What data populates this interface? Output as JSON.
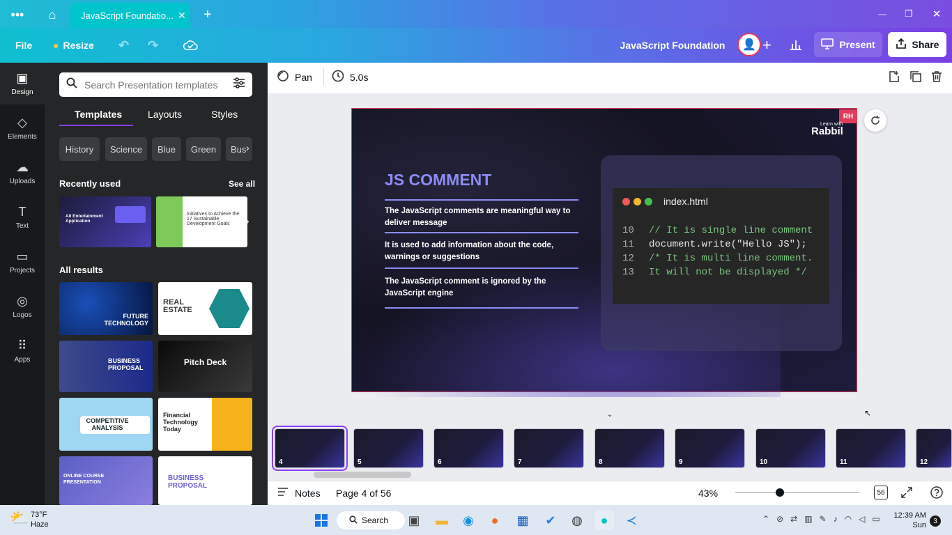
{
  "browser": {
    "tab_title": "JavaScript Foundatio...",
    "tab_close": "✕",
    "new_tab": "+",
    "window_controls": [
      "—",
      "❐",
      "✕"
    ]
  },
  "header": {
    "file": "File",
    "resize": "Resize",
    "doc_title": "JavaScript Foundation",
    "present": "Present",
    "share": "Share"
  },
  "rail": [
    "Design",
    "Elements",
    "Uploads",
    "Text",
    "Projects",
    "Logos",
    "Apps"
  ],
  "panel": {
    "search_placeholder": "Search Presentation templates",
    "tabs": [
      "Templates",
      "Layouts",
      "Styles"
    ],
    "chips": [
      "History",
      "Science",
      "Blue",
      "Green",
      "Bus"
    ],
    "recently_used": "Recently used",
    "see_all": "See all",
    "all_results": "All results",
    "recent": [
      {
        "title": "All Entertainment Application"
      },
      {
        "title": "Initiatives to Achieve the 17 Sustainable Development Goals"
      }
    ],
    "results": [
      {
        "title": "FUTURE TECHNOLOGY"
      },
      {
        "title": "REAL ESTATE"
      },
      {
        "title": "BUSINESS PROPOSAL"
      },
      {
        "title": "Pitch Deck"
      },
      {
        "title": "COMPETITIVE ANALYSIS"
      },
      {
        "title": "Financial Technology Today"
      },
      {
        "title": "ONLINE COURSE PRESENTATION"
      },
      {
        "title": "BUSINESS PROPOSAL"
      }
    ]
  },
  "toolbar": {
    "pan": "Pan",
    "duration": "5.0s"
  },
  "slide": {
    "badge": "RH",
    "logo_small": "Learn with",
    "logo_big": "Rabbil",
    "title": "JS COMMENT",
    "bullets": [
      "The JavaScript comments are meaningful way to deliver message",
      "It is used to add information about the code, warnings or suggestions",
      "The JavaScript comment is ignored by the JavaScript engine"
    ],
    "file_name": "index.html",
    "code": [
      {
        "num": "10",
        "text": "// It is single line comment",
        "color": "#7bc47f"
      },
      {
        "num": "11",
        "text": "document.write(\"Hello JS\");",
        "color": "#e8e8e8"
      },
      {
        "num": "12",
        "text": "/* It is multi line comment.",
        "color": "#7bc47f"
      },
      {
        "num": "13",
        "text": "It will not be displayed */",
        "color": "#7bc47f"
      }
    ]
  },
  "filmstrip": [
    "4",
    "5",
    "6",
    "7",
    "8",
    "9",
    "10",
    "11",
    "12"
  ],
  "status": {
    "notes": "Notes",
    "page": "Page 4 of 56",
    "zoom": "43%",
    "zoom_level": 0.36,
    "pages_count": "56"
  },
  "taskbar": {
    "temp": "73°F",
    "weather": "Haze",
    "search": "Search",
    "time": "12:39 AM",
    "day": "Sun",
    "notif": "3"
  }
}
